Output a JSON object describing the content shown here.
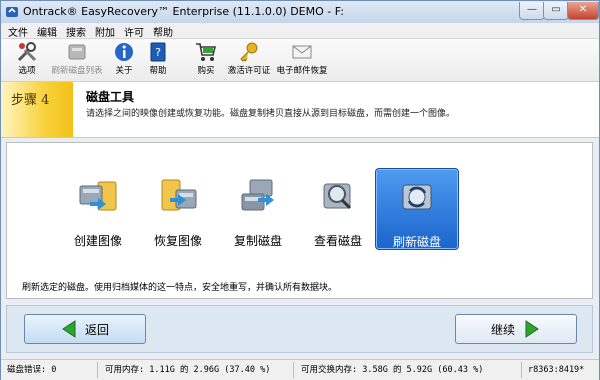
{
  "window": {
    "title": "Ontrack® EasyRecovery™ Enterprise (11.1.0.0) DEMO - F:",
    "min_glyph": "—",
    "max_glyph": "▭",
    "close_glyph": "✕"
  },
  "menu": [
    "文件",
    "编辑",
    "搜索",
    "附加",
    "许可",
    "帮助"
  ],
  "toolbar": [
    {
      "label": "选项",
      "icon": "tools-icon"
    },
    {
      "label": "刷新磁盘列表",
      "icon": "refresh-disk-list-icon",
      "disabled": true
    },
    {
      "label": "关于",
      "icon": "info-icon"
    },
    {
      "label": "帮助",
      "icon": "help-book-icon"
    },
    {
      "label": "购买",
      "icon": "cart-icon"
    },
    {
      "label": "激活许可证",
      "icon": "key-icon"
    },
    {
      "label": "电子邮件恢复",
      "icon": "email-icon"
    }
  ],
  "step": {
    "label": "步骤 4",
    "title": "磁盘工具",
    "description": "请选择之间的映像创建或恢复功能。磁盘复制拷贝直接从源到目标磁盘，而需创建一个图像。"
  },
  "tools": [
    {
      "label": "创建图像",
      "icon": "create-image-icon"
    },
    {
      "label": "恢复图像",
      "icon": "restore-image-icon"
    },
    {
      "label": "复制磁盘",
      "icon": "copy-disk-icon"
    },
    {
      "label": "查看磁盘",
      "icon": "view-disk-icon"
    },
    {
      "label": "刷新磁盘",
      "icon": "refresh-disk-icon",
      "selected": true
    }
  ],
  "tool_description": "刷新选定的磁盘。使用归档媒体的这一特点，安全地重写，并确认所有数据块。",
  "nav": {
    "back_label": "返回",
    "next_label": "继续"
  },
  "status": {
    "disk_errors": "磁盘错误: 0",
    "memory": "可用内存: 1.11G 的 2.96G (37.40 %)",
    "swap": "可用交换内存: 3.58G 的 5.92G (60.43 %)",
    "build": "r8363:8419*"
  },
  "colors": {
    "accent": "#1a64cc",
    "step_yellow": "#f2c11a",
    "arrow_green": "#2fa52f"
  }
}
